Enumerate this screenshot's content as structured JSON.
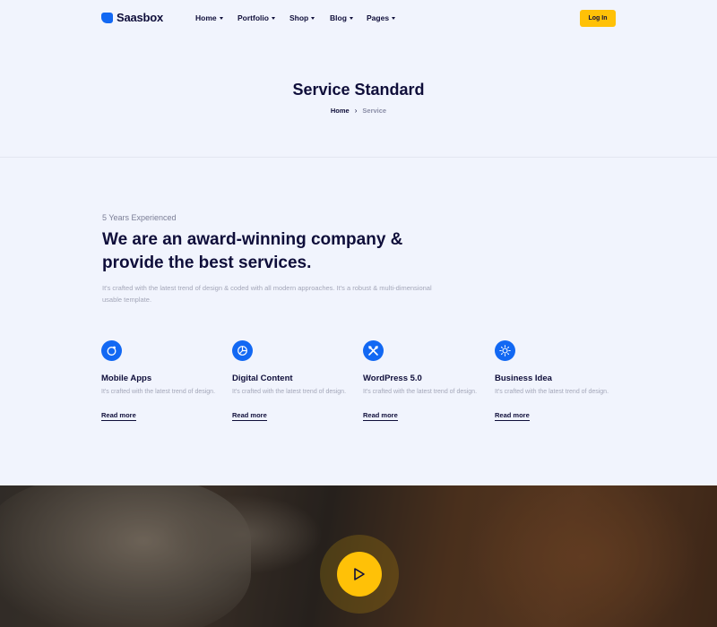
{
  "header": {
    "logo_text": "Saasbox",
    "nav": [
      {
        "label": "Home"
      },
      {
        "label": "Portfolio"
      },
      {
        "label": "Shop"
      },
      {
        "label": "Blog"
      },
      {
        "label": "Pages"
      }
    ],
    "login_label": "Log In"
  },
  "page": {
    "title": "Service Standard",
    "breadcrumb": {
      "home": "Home",
      "separator": "›",
      "current": "Service"
    }
  },
  "about": {
    "eyebrow": "5 Years Experienced",
    "headline": "We are an award-winning company & provide the best services.",
    "lead": "It's crafted with the latest trend of design & coded with all modern approaches. It's a robust & multi-dimensional usable template."
  },
  "features": [
    {
      "icon": "mobile-apps-icon",
      "title": "Mobile Apps",
      "desc": "It's crafted with the latest trend of design.",
      "link": "Read more"
    },
    {
      "icon": "pie-chart-icon",
      "title": "Digital Content",
      "desc": "It's crafted with the latest trend of design.",
      "link": "Read more"
    },
    {
      "icon": "tools-icon",
      "title": "WordPress 5.0",
      "desc": "It's crafted with the latest trend of design.",
      "link": "Read more"
    },
    {
      "icon": "lightbulb-icon",
      "title": "Business Idea",
      "desc": "It's crafted with the latest trend of design.",
      "link": "Read more"
    }
  ],
  "colors": {
    "accent_blue": "#1268f3",
    "accent_yellow": "#ffc107",
    "heading": "#0f0e3a",
    "background": "#f1f4fd"
  },
  "video": {
    "play_icon": "play-icon"
  }
}
